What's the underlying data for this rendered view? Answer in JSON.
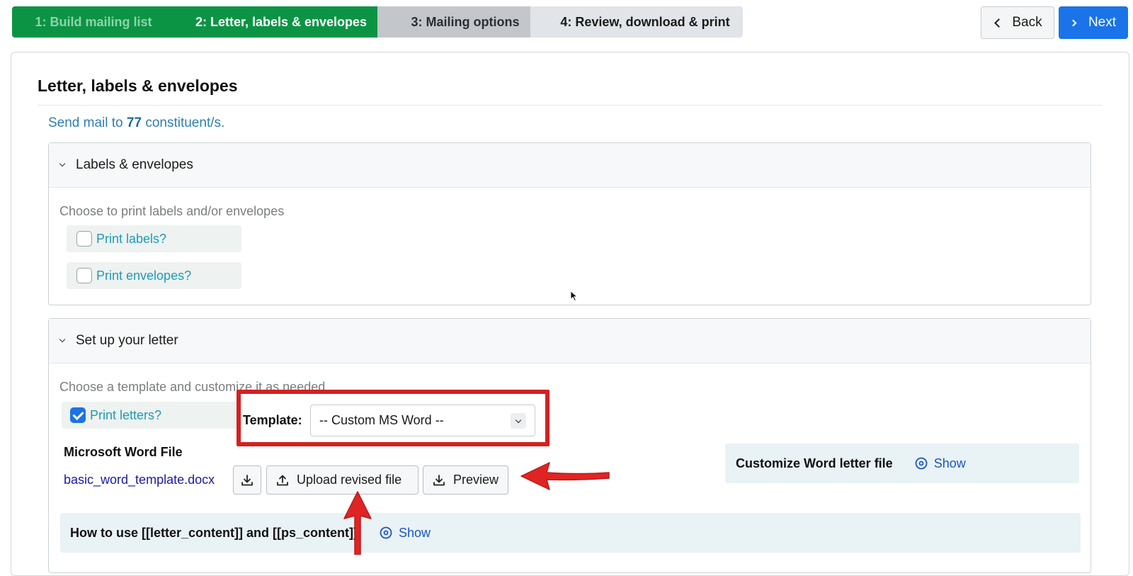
{
  "wizard": {
    "steps": [
      {
        "label": "1: Build mailing list",
        "state": "done"
      },
      {
        "label": "2: Letter, labels & envelopes",
        "state": "active"
      },
      {
        "label": "3: Mailing options",
        "state": "upcoming"
      },
      {
        "label": "4: Review, download & print",
        "state": "upcoming"
      }
    ],
    "back_label": "Back",
    "next_label": "Next"
  },
  "page": {
    "title": "Letter, labels & envelopes",
    "send_prefix": "Send mail to",
    "count": "77",
    "send_suffix": "constituent/s."
  },
  "labels_section": {
    "title": "Labels & envelopes",
    "help": "Choose to print labels and/or envelopes",
    "options": [
      {
        "label": "Print labels?",
        "checked": false
      },
      {
        "label": "Print envelopes?",
        "checked": false
      }
    ]
  },
  "letter_section": {
    "title": "Set up your letter",
    "help": "Choose a template and customize it as needed",
    "print_letters": {
      "label": "Print letters?",
      "checked": true
    },
    "template_label": "Template:",
    "template_value": "-- Custom MS Word --",
    "word_file_title": "Microsoft Word File",
    "file_name": "basic_word_template.docx",
    "upload_label": "Upload revised file",
    "preview_label": "Preview",
    "customize_title": "Customize Word letter file",
    "customize_show": "Show",
    "howto_title": "How to use [[letter_content]] and [[ps_content]]",
    "howto_show": "Show"
  },
  "colors": {
    "step_active": "#0b9444",
    "step_upcoming": "#c3c7cc",
    "primary": "#1a73e8",
    "annotation": "#d42020"
  }
}
